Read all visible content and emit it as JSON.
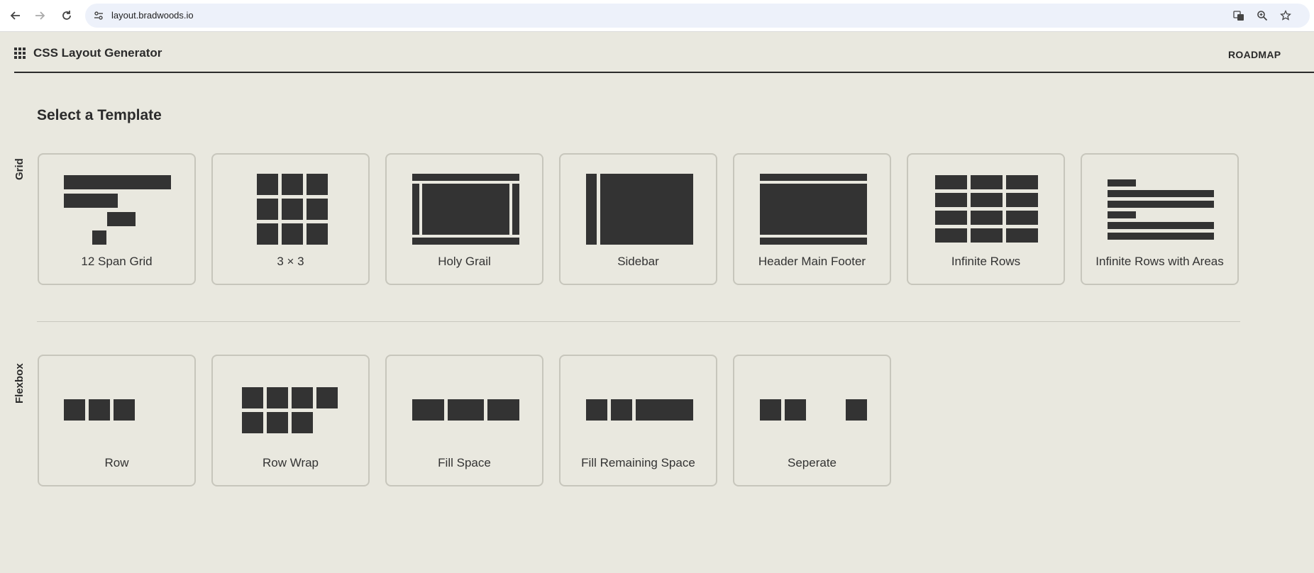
{
  "browser": {
    "url": "layout.bradwoods.io"
  },
  "header": {
    "title": "CSS Layout Generator",
    "roadmap_label": "ROADMAP"
  },
  "main": {
    "title": "Select a Template",
    "grid_section": {
      "label": "Grid",
      "templates": [
        {
          "label": "12 Span Grid"
        },
        {
          "label": "3 × 3"
        },
        {
          "label": "Holy Grail"
        },
        {
          "label": "Sidebar"
        },
        {
          "label": "Header Main Footer"
        },
        {
          "label": "Infinite Rows"
        },
        {
          "label": "Infinite Rows with Areas"
        }
      ]
    },
    "flexbox_section": {
      "label": "Flexbox",
      "templates": [
        {
          "label": "Row"
        },
        {
          "label": "Row Wrap"
        },
        {
          "label": "Fill Space"
        },
        {
          "label": "Fill Remaining Space"
        },
        {
          "label": "Seperate"
        }
      ]
    }
  },
  "colors": {
    "background": "#e9e8df",
    "ink": "#333333",
    "card_border": "#c7c6bc"
  }
}
